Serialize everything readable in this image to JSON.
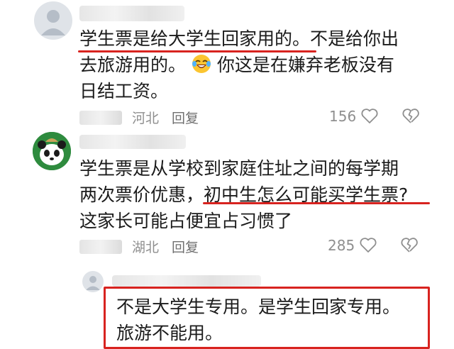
{
  "comments": [
    {
      "text_lines": [
        "学生票是给大学生回家用的。不是给你出",
        "去旅游用的。",
        "你这是在嫌弃老板没有",
        "日结工资。"
      ],
      "region": "河北",
      "reply_label": "回复",
      "likes": "156",
      "emoji": "laughing-with-tears"
    },
    {
      "text_lines": [
        "学生票是从学校到家庭住址之间的每学期",
        "两次票价优惠，初中生怎么可能买学生票?",
        "这家长可能占便宜占习惯了"
      ],
      "region": "湖北",
      "reply_label": "回复",
      "likes": "285"
    }
  ],
  "reply": {
    "text_lines": [
      "不是大学生专用。是学生回家专用。",
      "旅游不能用。"
    ]
  },
  "colors": {
    "highlight": "#d8231f",
    "meta_text": "#8f8f8f"
  }
}
